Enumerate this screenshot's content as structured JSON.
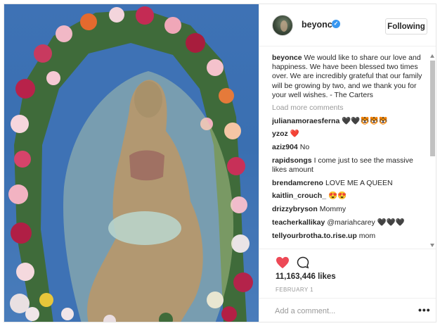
{
  "post": {
    "username": "beyonce",
    "follow_label": "Following",
    "caption": {
      "username": "beyonce",
      "text": "We would like to share our love and happiness. We have been blessed two times over. We are incredibly grateful that our family will be growing by two, and we thank you for your well wishes. - The Carters"
    },
    "load_more_label": "Load more comments",
    "comments": [
      {
        "username": "julianamoraesferna",
        "text": "🖤🖤🐯🐯🐯"
      },
      {
        "username": "yzoz",
        "text": "❤️"
      },
      {
        "username": "aziz904",
        "text": "No"
      },
      {
        "username": "rapidsongs",
        "text": "I come just to see the massive likes amount"
      },
      {
        "username": "brendamcreno",
        "text": "LOVE ME A QUEEN"
      },
      {
        "username": "kaitlin_crouch_",
        "text": "😍😍"
      },
      {
        "username": "drizzybryson",
        "text": "Mommy"
      },
      {
        "username": "teacherkallikay",
        "text": "@mariahcarey 🖤🖤🖤"
      },
      {
        "username": "tellyourbrotha.to.rise.up",
        "text": "mom"
      }
    ],
    "likes": "11,163,446 likes",
    "date": "FEBRUARY 1",
    "add_comment_placeholder": "Add a comment...",
    "more_options": "•••"
  },
  "icons": {
    "heart": "heart-icon",
    "comment": "comment-icon",
    "verified": "verified-badge-icon",
    "more": "more-options-icon"
  },
  "colors": {
    "heart": "#ed4956",
    "verified": "#3897f0",
    "muted_text": "#999999",
    "border": "#efefef"
  }
}
